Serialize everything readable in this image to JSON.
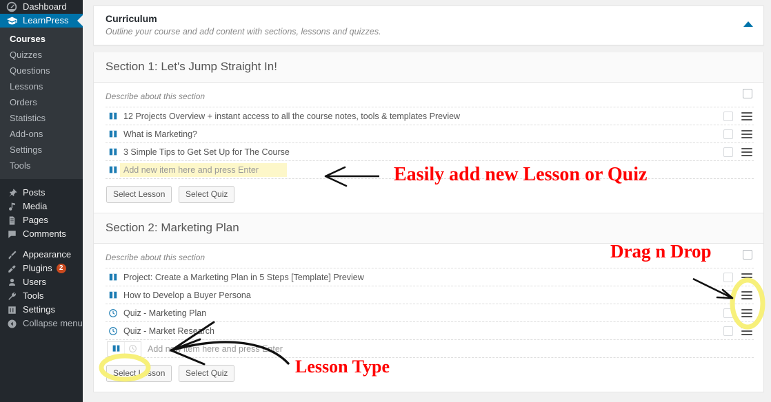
{
  "sidebar": {
    "items": [
      {
        "label": "Dashboard",
        "icon": "dashboard-icon",
        "current": false
      },
      {
        "label": "LearnPress",
        "icon": "graduation-cap-icon",
        "current": true
      }
    ],
    "submenu": [
      {
        "label": "Courses",
        "active": true
      },
      {
        "label": "Quizzes",
        "active": false
      },
      {
        "label": "Questions",
        "active": false
      },
      {
        "label": "Lessons",
        "active": false
      },
      {
        "label": "Orders",
        "active": false
      },
      {
        "label": "Statistics",
        "active": false
      },
      {
        "label": "Add-ons",
        "active": false
      },
      {
        "label": "Settings",
        "active": false
      },
      {
        "label": "Tools",
        "active": false
      }
    ],
    "items2": [
      {
        "label": "Posts",
        "icon": "pin-icon"
      },
      {
        "label": "Media",
        "icon": "media-icon"
      },
      {
        "label": "Pages",
        "icon": "page-icon"
      },
      {
        "label": "Comments",
        "icon": "comment-icon"
      }
    ],
    "items3": [
      {
        "label": "Appearance",
        "icon": "brush-icon",
        "badge": ""
      },
      {
        "label": "Plugins",
        "icon": "plug-icon",
        "badge": "2"
      },
      {
        "label": "Users",
        "icon": "user-icon",
        "badge": ""
      },
      {
        "label": "Tools",
        "icon": "wrench-icon",
        "badge": ""
      },
      {
        "label": "Settings",
        "icon": "settings-icon",
        "badge": ""
      }
    ],
    "collapse": {
      "label": "Collapse menu",
      "icon": "collapse-arrow-icon"
    },
    "accent_color": "#0073aa",
    "background_color": "#23282d"
  },
  "panel": {
    "title": "Curriculum",
    "subtitle": "Outline your course and add content with sections, lessons and quizzes.",
    "toggle_icon": "triangle-up-icon"
  },
  "sections": [
    {
      "title": "Section 1: Let's Jump Straight In!",
      "description_placeholder": "Describe about this section",
      "items": [
        {
          "title": "12 Projects Overview + instant access to all the course notes, tools & templates Preview",
          "type": "lesson",
          "icon": "book-icon",
          "placeholder": false,
          "highlight": false
        },
        {
          "title": "What is Marketing?",
          "type": "lesson",
          "icon": "book-icon",
          "placeholder": false,
          "highlight": false
        },
        {
          "title": "3 Simple Tips to Get Set Up for The Course",
          "type": "lesson",
          "icon": "book-icon",
          "placeholder": false,
          "highlight": false
        },
        {
          "title": "Add new item here and press Enter",
          "type": "lesson",
          "icon": "book-icon",
          "placeholder": true,
          "highlight": true
        }
      ],
      "buttons": [
        {
          "label": "Select Lesson"
        },
        {
          "label": "Select Quiz"
        }
      ]
    },
    {
      "title": "Section 2: Marketing Plan",
      "description_placeholder": "Describe about this section",
      "items": [
        {
          "title": "Project: Create a Marketing Plan in 5 Steps [Template] Preview",
          "type": "lesson",
          "icon": "book-icon",
          "placeholder": false,
          "highlight": false
        },
        {
          "title": "How to Develop a Buyer Persona",
          "type": "lesson",
          "icon": "book-icon",
          "placeholder": false,
          "highlight": false
        },
        {
          "title": "Quiz - Marketing Plan",
          "type": "quiz",
          "icon": "clock-icon",
          "placeholder": false,
          "highlight": false
        },
        {
          "title": "Quiz - Market Research",
          "type": "quiz",
          "icon": "clock-icon",
          "placeholder": false,
          "highlight": false
        },
        {
          "title": "Add new item here and press Enter",
          "type": "new",
          "icon": "type-toggle",
          "placeholder": true,
          "highlight": false
        }
      ],
      "buttons": [
        {
          "label": "Select Lesson"
        },
        {
          "label": "Select Quiz"
        }
      ]
    }
  ],
  "annotations": [
    {
      "id": "add-item-note",
      "text": "Easily add new Lesson or Quiz",
      "color": "#ff0000"
    },
    {
      "id": "drag-drop-note",
      "text": "Drag n Drop",
      "color": "#ff0000"
    },
    {
      "id": "lesson-type-note",
      "text": "Lesson Type",
      "color": "#ff0000"
    }
  ]
}
